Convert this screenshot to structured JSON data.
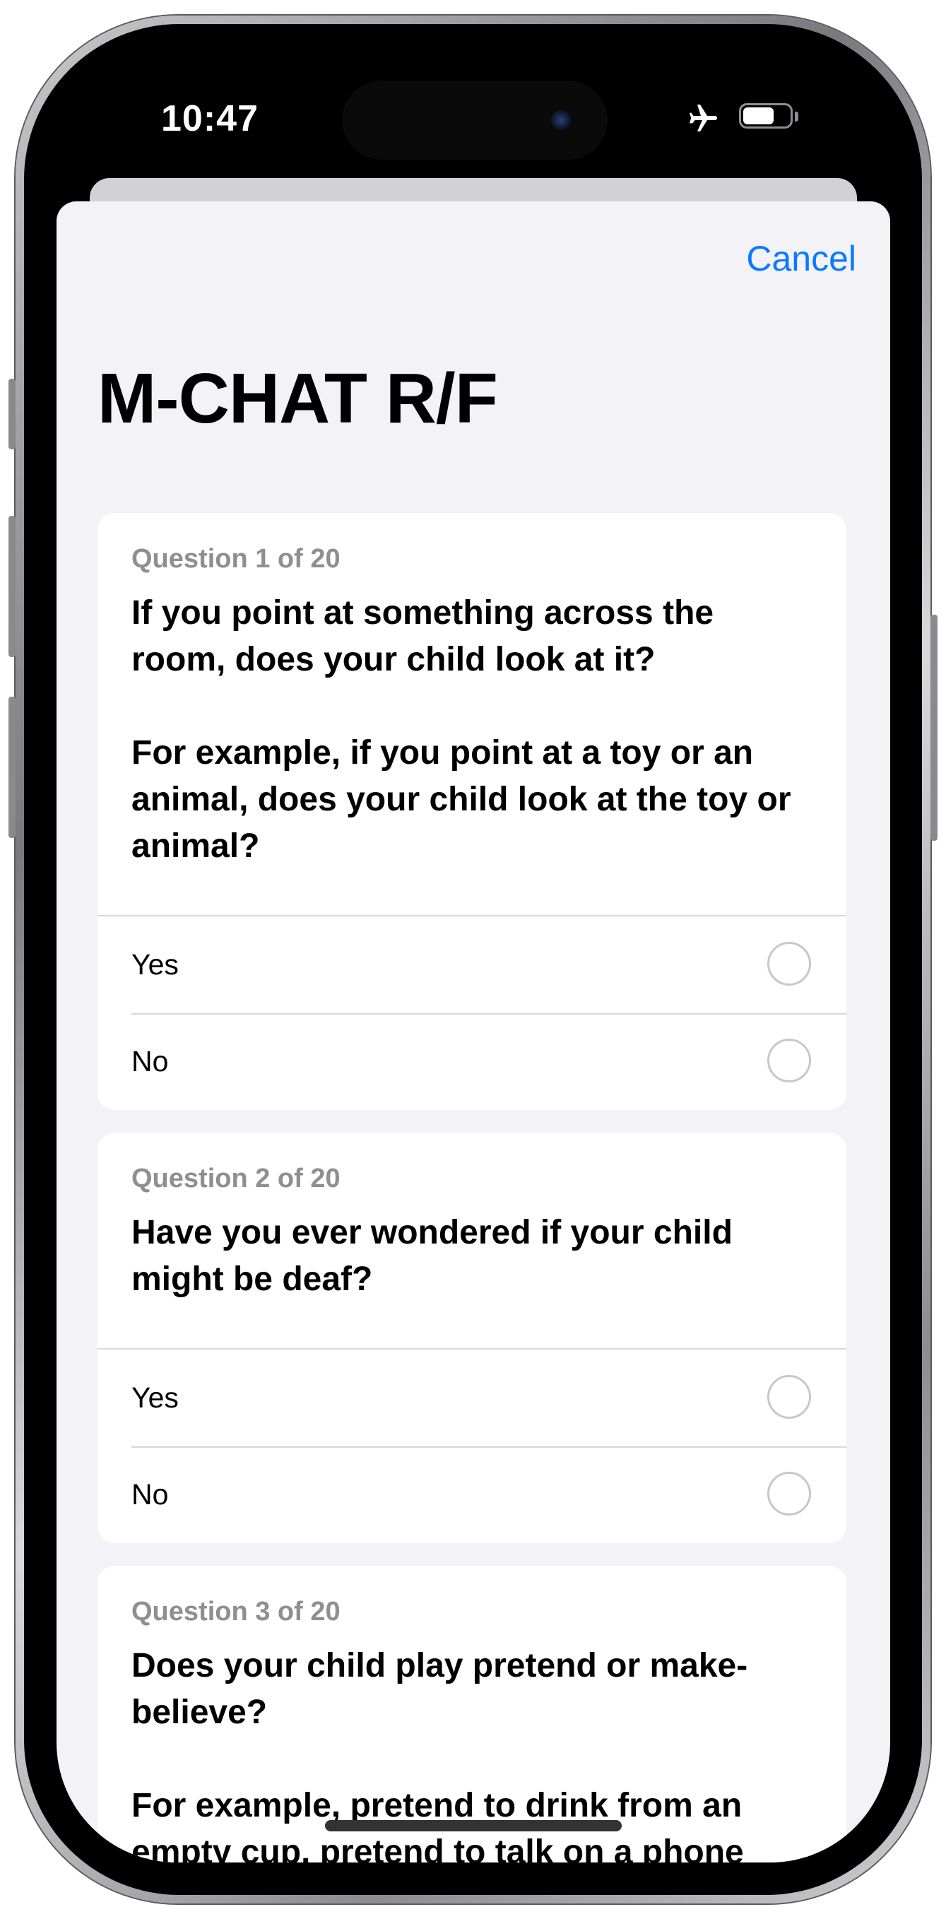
{
  "status_bar": {
    "time": "10:47",
    "icons": [
      "airplane-mode-icon",
      "battery-icon"
    ]
  },
  "header": {
    "cancel_label": "Cancel",
    "title": "M-CHAT R/F"
  },
  "questions": [
    {
      "number_label": "Question 1 of 20",
      "text": "If you point at something across the room, does your child look at it?\n\nFor example, if you point at a toy or an animal, does your child look at the toy or animal?",
      "options": [
        "Yes",
        "No"
      ]
    },
    {
      "number_label": "Question 2 of 20",
      "text": "Have you ever wondered if your child might be deaf?",
      "options": [
        "Yes",
        "No"
      ]
    },
    {
      "number_label": "Question 3 of 20",
      "text": "Does your child play pretend or make-believe?\n\nFor example, pretend to drink from an empty cup, pretend to talk on a phone",
      "options": []
    }
  ],
  "colors": {
    "accent": "#0a7aff",
    "sheet_background": "#f2f2f7",
    "secondary_text": "#8e8e93"
  }
}
